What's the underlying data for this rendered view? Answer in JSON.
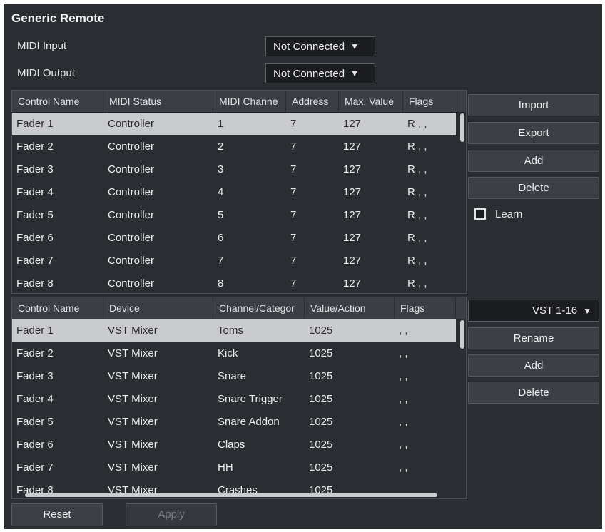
{
  "window": {
    "title": "Generic Remote"
  },
  "midi": {
    "input_label": "MIDI Input",
    "input_value": "Not Connected",
    "output_label": "MIDI Output",
    "output_value": "Not Connected",
    "caret": "▼"
  },
  "upper_table": {
    "headers": [
      "Control Name",
      "MIDI Status",
      "MIDI Channe",
      "Address",
      "Max. Value",
      "Flags"
    ],
    "rows": [
      [
        "Fader 1",
        "Controller",
        "1",
        "7",
        "127",
        "R , ,"
      ],
      [
        "Fader 2",
        "Controller",
        "2",
        "7",
        "127",
        "R , ,"
      ],
      [
        "Fader 3",
        "Controller",
        "3",
        "7",
        "127",
        "R , ,"
      ],
      [
        "Fader 4",
        "Controller",
        "4",
        "7",
        "127",
        "R , ,"
      ],
      [
        "Fader 5",
        "Controller",
        "5",
        "7",
        "127",
        "R , ,"
      ],
      [
        "Fader 6",
        "Controller",
        "6",
        "7",
        "127",
        "R , ,"
      ],
      [
        "Fader 7",
        "Controller",
        "7",
        "7",
        "127",
        "R , ,"
      ],
      [
        "Fader 8",
        "Controller",
        "8",
        "7",
        "127",
        "R , ,"
      ]
    ],
    "selected_row": 0
  },
  "upper_buttons": {
    "import": "Import",
    "export": "Export",
    "add": "Add",
    "delete": "Delete",
    "learn": "Learn"
  },
  "lower_table": {
    "headers": [
      "Control Name",
      "Device",
      "Channel/Categor",
      "Value/Action",
      "Flags"
    ],
    "rows": [
      [
        "Fader 1",
        "VST Mixer",
        "Toms",
        "1025",
        ", ,"
      ],
      [
        "Fader 2",
        "VST Mixer",
        "Kick",
        "1025",
        ", ,"
      ],
      [
        "Fader 3",
        "VST Mixer",
        "Snare",
        "1025",
        ", ,"
      ],
      [
        "Fader 4",
        "VST Mixer",
        "Snare Trigger",
        "1025",
        ", ,"
      ],
      [
        "Fader 5",
        "VST Mixer",
        "Snare Addon",
        "1025",
        ", ,"
      ],
      [
        "Fader 6",
        "VST Mixer",
        "Claps",
        "1025",
        ", ,"
      ],
      [
        "Fader 7",
        "VST Mixer",
        "HH",
        "1025",
        ", ,"
      ],
      [
        "Fader 8",
        "VST Mixer",
        "Crashes",
        "1025",
        ""
      ]
    ],
    "selected_row": 0
  },
  "bank": {
    "value": "VST 1-16",
    "caret": "▼"
  },
  "lower_buttons": {
    "rename": "Rename",
    "add": "Add",
    "delete": "Delete"
  },
  "footer": {
    "reset": "Reset",
    "apply": "Apply"
  },
  "colors": {
    "panel_bg": "#2a2d31",
    "header_bg": "#3b3f45",
    "selected_row_bg": "#c9cbce",
    "button_bg": "#3c3f45"
  }
}
